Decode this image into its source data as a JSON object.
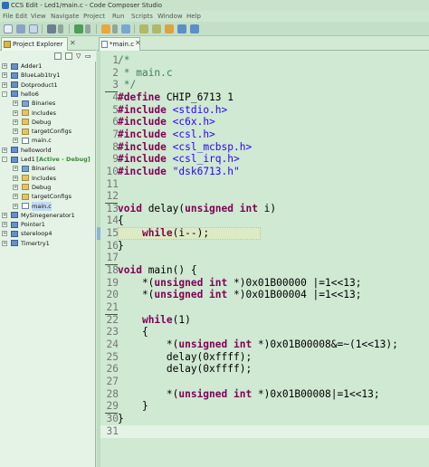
{
  "window": {
    "title": "CCS Edit - Led1/main.c - Code Composer Studio"
  },
  "menu": [
    "File",
    "Edit",
    "View",
    "Navigate",
    "Project",
    "Run",
    "Scripts",
    "Window",
    "Help"
  ],
  "explorer": {
    "tab_label": "Project Explorer",
    "tree": [
      {
        "label": "Adder1",
        "depth": 0,
        "kind": "project",
        "expander": "+"
      },
      {
        "label": "BlueLab1try1",
        "depth": 0,
        "kind": "project",
        "expander": "+"
      },
      {
        "label": "Dotproduct1",
        "depth": 0,
        "kind": "project",
        "expander": "+"
      },
      {
        "label": "hello6",
        "depth": 0,
        "kind": "project",
        "expander": "-"
      },
      {
        "label": "Binaries",
        "depth": 1,
        "kind": "bin",
        "expander": "+"
      },
      {
        "label": "Includes",
        "depth": 1,
        "kind": "folder",
        "expander": "+"
      },
      {
        "label": "Debug",
        "depth": 1,
        "kind": "folder",
        "expander": "+"
      },
      {
        "label": "targetConfigs",
        "depth": 1,
        "kind": "folder",
        "expander": "+"
      },
      {
        "label": "main.c",
        "depth": 1,
        "kind": "file",
        "expander": "+"
      },
      {
        "label": "helloworld",
        "depth": 0,
        "kind": "project",
        "expander": "+"
      },
      {
        "label": "Led1",
        "active": "[Active - Debug]",
        "depth": 0,
        "kind": "project",
        "expander": "-"
      },
      {
        "label": "Binaries",
        "depth": 1,
        "kind": "bin",
        "expander": "+"
      },
      {
        "label": "Includes",
        "depth": 1,
        "kind": "folder",
        "expander": "+"
      },
      {
        "label": "Debug",
        "depth": 1,
        "kind": "folder",
        "expander": "+"
      },
      {
        "label": "targetConfigs",
        "depth": 1,
        "kind": "folder",
        "expander": "+"
      },
      {
        "label": "main.c",
        "depth": 1,
        "kind": "file",
        "expander": "+",
        "selected": true
      },
      {
        "label": "MySinegenerator1",
        "depth": 0,
        "kind": "project",
        "expander": "+"
      },
      {
        "label": "Pointer1",
        "depth": 0,
        "kind": "project",
        "expander": "+"
      },
      {
        "label": "stereloop4",
        "depth": 0,
        "kind": "project",
        "expander": "+"
      },
      {
        "label": "Timertry1",
        "depth": 0,
        "kind": "project",
        "expander": "+"
      }
    ]
  },
  "editor": {
    "tab_label": "*main.c",
    "current_line": 31,
    "lines": [
      {
        "n": "1",
        "t": [
          [
            "cm",
            "/*"
          ]
        ]
      },
      {
        "n": "2",
        "t": [
          [
            "cm",
            " * main.c"
          ]
        ]
      },
      {
        "n": "3",
        "t": [
          [
            "cm",
            " */"
          ]
        ]
      },
      {
        "n": "4",
        "t": [
          [
            "mc",
            "#define"
          ],
          [
            "",
            " CHIP_6713 1"
          ]
        ]
      },
      {
        "n": "5",
        "t": [
          [
            "mc",
            "#include"
          ],
          [
            "",
            " "
          ],
          [
            "st",
            "<stdio.h>"
          ]
        ]
      },
      {
        "n": "6",
        "t": [
          [
            "mc",
            "#include"
          ],
          [
            "",
            " "
          ],
          [
            "st",
            "<c6x.h>"
          ]
        ]
      },
      {
        "n": "7",
        "t": [
          [
            "mc",
            "#include"
          ],
          [
            "",
            " "
          ],
          [
            "st",
            "<csl.h>"
          ]
        ]
      },
      {
        "n": "8",
        "t": [
          [
            "mc",
            "#include"
          ],
          [
            "",
            " "
          ],
          [
            "st",
            "<csl_mcbsp.h>"
          ]
        ]
      },
      {
        "n": "9",
        "t": [
          [
            "mc",
            "#include"
          ],
          [
            "",
            " "
          ],
          [
            "st",
            "<csl_irq.h>"
          ]
        ]
      },
      {
        "n": "10",
        "t": [
          [
            "mc",
            "#include"
          ],
          [
            "",
            " "
          ],
          [
            "st",
            "\"dsk6713.h\""
          ]
        ]
      },
      {
        "n": "11",
        "t": []
      },
      {
        "n": "12",
        "t": []
      },
      {
        "n": "13",
        "t": [
          [
            "kw",
            "void"
          ],
          [
            "",
            " delay("
          ],
          [
            "kw",
            "unsigned int"
          ],
          [
            "",
            " i)"
          ]
        ]
      },
      {
        "n": "14",
        "t": [
          [
            "",
            "{"
          ]
        ]
      },
      {
        "n": "15",
        "t": [
          [
            "",
            "    "
          ],
          [
            "kw",
            "while"
          ],
          [
            "",
            "(i--);"
          ]
        ]
      },
      {
        "n": "16",
        "t": [
          [
            "",
            "}"
          ]
        ]
      },
      {
        "n": "17",
        "t": []
      },
      {
        "n": "18",
        "t": [
          [
            "kw",
            "void"
          ],
          [
            "",
            " main() {"
          ]
        ]
      },
      {
        "n": "19",
        "t": [
          [
            "",
            "    *("
          ],
          [
            "kw",
            "unsigned int"
          ],
          [
            "",
            " *)0x01B00000 |=1<<13;"
          ]
        ]
      },
      {
        "n": "20",
        "t": [
          [
            "",
            "    *("
          ],
          [
            "kw",
            "unsigned int"
          ],
          [
            "",
            " *)0x01B00004 |=1<<13;"
          ]
        ]
      },
      {
        "n": "21",
        "t": []
      },
      {
        "n": "22",
        "t": [
          [
            "",
            "    "
          ],
          [
            "kw",
            "while"
          ],
          [
            "",
            "(1)"
          ]
        ]
      },
      {
        "n": "23",
        "t": [
          [
            "",
            "    {"
          ]
        ]
      },
      {
        "n": "24",
        "t": [
          [
            "",
            "        *("
          ],
          [
            "kw",
            "unsigned int"
          ],
          [
            "",
            " *)0x01B00008&=~(1<<13);"
          ]
        ]
      },
      {
        "n": "25",
        "t": [
          [
            "",
            "        delay(0xffff);"
          ]
        ]
      },
      {
        "n": "26",
        "t": [
          [
            "",
            "        delay(0xffff);"
          ]
        ]
      },
      {
        "n": "27",
        "t": []
      },
      {
        "n": "28",
        "t": [
          [
            "",
            "        *("
          ],
          [
            "kw",
            "unsigned int"
          ],
          [
            "",
            " *)0x01B00008|=1<<13;"
          ]
        ]
      },
      {
        "n": "29",
        "t": [
          [
            "",
            "    }"
          ]
        ]
      },
      {
        "n": "30",
        "t": [
          [
            "",
            "}"
          ]
        ]
      },
      {
        "n": "31",
        "t": []
      }
    ]
  }
}
